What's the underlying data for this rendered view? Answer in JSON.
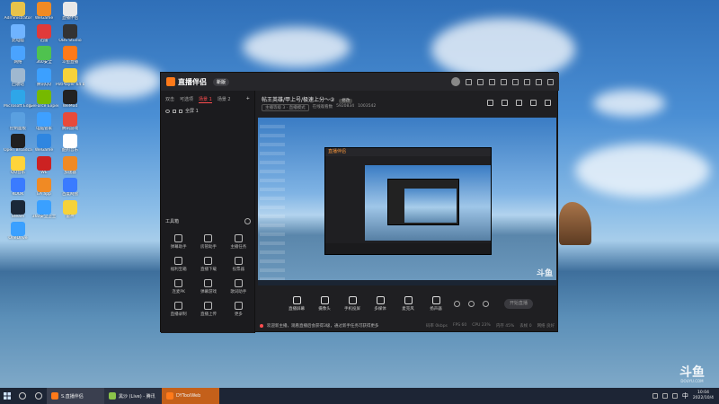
{
  "desktop": {
    "icons": [
      {
        "label": "Administrator",
        "color": "#e8c34a"
      },
      {
        "label": "WeGame",
        "color": "#f08a24"
      },
      {
        "label": "直播伴侣",
        "color": "#e8e8e8"
      },
      {
        "label": "此电脑",
        "color": "#6fb3ff"
      },
      {
        "label": "迅雷",
        "color": "#e03a3a"
      },
      {
        "label": "OBS Studio",
        "color": "#333333"
      },
      {
        "label": "网络",
        "color": "#4aa3ff"
      },
      {
        "label": "360安全",
        "color": "#4fc24f"
      },
      {
        "label": "斗鱼直播",
        "color": "#ff7a1a"
      },
      {
        "label": "回收站",
        "color": "#9fb8d0"
      },
      {
        "label": "腾讯QQ",
        "color": "#3ca0ff"
      },
      {
        "label": "PotPlayer 64 bit",
        "color": "#f6d23a"
      },
      {
        "label": "Microsoft Edge",
        "color": "#2ea6e8"
      },
      {
        "label": "GeForce Experience",
        "color": "#76b900"
      },
      {
        "label": "WeMod",
        "color": "#222222"
      },
      {
        "label": "控制面板",
        "color": "#5aa0e0"
      },
      {
        "label": "电脑管家",
        "color": "#3ea0ff"
      },
      {
        "label": "腾讯游戏",
        "color": "#e84a3a"
      },
      {
        "label": "Open Broadcaster",
        "color": "#202020"
      },
      {
        "label": "WeGame",
        "color": "#2f86e0"
      },
      {
        "label": "酷狗音乐",
        "color": "#ffffff"
      },
      {
        "label": "QQ音乐",
        "color": "#ffd43a"
      },
      {
        "label": "WE",
        "color": "#cc2222"
      },
      {
        "label": "加速器",
        "color": "#f08a24"
      },
      {
        "label": "KOOK",
        "color": "#3a7bff"
      },
      {
        "label": "EA app",
        "color": "#f08a24"
      },
      {
        "label": "百度网盘",
        "color": "#3a7bff"
      },
      {
        "label": "Steam",
        "color": "#1b2838"
      },
      {
        "label": "360安全卫士",
        "color": "#3aa0ff"
      },
      {
        "label": "雷神",
        "color": "#f6d23a"
      },
      {
        "label": "OneDrive",
        "color": "#3aa0ff"
      }
    ]
  },
  "app": {
    "logo": "直播伴侣",
    "version": "新版",
    "sidebar": {
      "tabs": [
        "双击",
        "可选项",
        "场景 1",
        "场景 2"
      ],
      "active_tab": 2,
      "add": "+",
      "scene_item": "全屏 1",
      "tools_title": "工具箱",
      "tools": [
        {
          "icon": "danmaku-icon",
          "label": "弹幕助手"
        },
        {
          "icon": "user-icon",
          "label": "房管助手"
        },
        {
          "icon": "task-icon",
          "label": "主播任务"
        },
        {
          "icon": "gift-icon",
          "label": "福利宝箱"
        },
        {
          "icon": "download-icon",
          "label": "直播下载"
        },
        {
          "icon": "vote-icon",
          "label": "投票器"
        },
        {
          "icon": "link-icon",
          "label": "连麦PK"
        },
        {
          "icon": "game-icon",
          "label": "弹幕游戏"
        },
        {
          "icon": "song-icon",
          "label": "歌词助手"
        },
        {
          "icon": "record-icon",
          "label": "直播录制"
        },
        {
          "icon": "upload-icon",
          "label": "直播上传"
        },
        {
          "icon": "more-icon",
          "label": "更多"
        }
      ]
    },
    "room": {
      "title": "帖王英雄/甲上号/极速上分～②",
      "tag": "修改",
      "meta": [
        "主播等级 3 · 直播模式",
        "在线观看数",
        "5920834",
        "1003542"
      ]
    },
    "bottom_tools": [
      {
        "icon": "screen-capture-icon",
        "label": "直播屏幕"
      },
      {
        "icon": "camera-icon",
        "label": "摄像头"
      },
      {
        "icon": "phone-icon",
        "label": "手机投屏"
      },
      {
        "icon": "media-icon",
        "label": "多媒体"
      },
      {
        "icon": "mic-icon",
        "label": "麦克风"
      },
      {
        "icon": "speaker-icon",
        "label": "扬声器"
      }
    ],
    "start_live": "开始直播",
    "notice": "欢迎新主播，观看直播后会获得3级，通过新手任务可获得更多",
    "stats": [
      "码率 0kbps",
      "FPS 60",
      "CPU 23%",
      "内存 45%",
      "丢帧 0",
      "网络 良好"
    ]
  },
  "watermark": {
    "big": "斗鱼",
    "small": "DOUYU.COM"
  },
  "taskbar": {
    "apps": [
      {
        "label": "S.直播伴侣",
        "color": "#ff7a1a"
      },
      {
        "label": "黑沙 (Live) - 腾讯",
        "color": "#8bc34a"
      },
      {
        "label": "DYToolWeb",
        "color": "#ff7a1a"
      }
    ],
    "time": "10:04",
    "date": "2022/10/4",
    "lang": "中"
  }
}
